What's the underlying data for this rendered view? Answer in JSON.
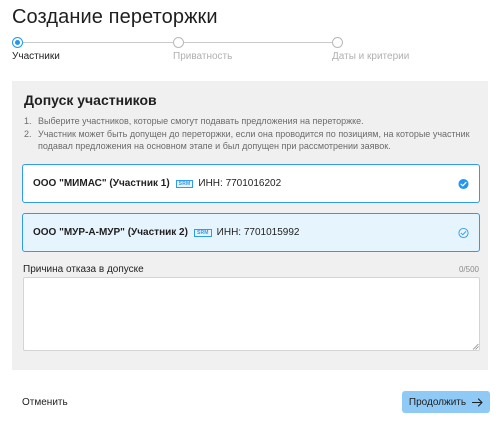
{
  "page": {
    "title": "Создание переторжки"
  },
  "stepper": {
    "steps": [
      {
        "label": "Участники",
        "active": true
      },
      {
        "label": "Приватность",
        "active": false
      },
      {
        "label": "Даты и критерии",
        "active": false
      }
    ]
  },
  "panel": {
    "title": "Допуск участников",
    "instructions": [
      {
        "num": "1.",
        "text": "Выберите участников, которые смогут подавать предложения на переторжке."
      },
      {
        "num": "2.",
        "text": "Участник может быть допущен до переторжки, если она проводится по позициям, на которые участник подавал предложения на основном этапе и был допущен при рассмотрении заявок."
      }
    ],
    "participants": [
      {
        "name": "ООО \"МИМАС\" (Участник 1)",
        "badge": "SRM",
        "inn": "ИНН: 7701016202",
        "checked": true,
        "check_icon": "check-circle-filled-icon"
      },
      {
        "name": "ООО \"МУР-А-МУР\" (Участник 2)",
        "badge": "SRM",
        "inn": "ИНН: 7701015992",
        "checked": false,
        "check_icon": "check-circle-outline-icon"
      }
    ],
    "reason": {
      "label": "Причина отказа в допуске",
      "counter": "0/500",
      "value": "",
      "placeholder": ""
    }
  },
  "footer": {
    "cancel_label": "Отменить",
    "continue_label": "Продолжить",
    "continue_icon": "arrow-right-icon"
  },
  "colors": {
    "accent": "#2196f3",
    "card_border": "#2f9bf0",
    "selected_bg": "#e6f4fd",
    "panel_bg": "#f0f0f0",
    "continue_bg": "#8fc9f5"
  }
}
